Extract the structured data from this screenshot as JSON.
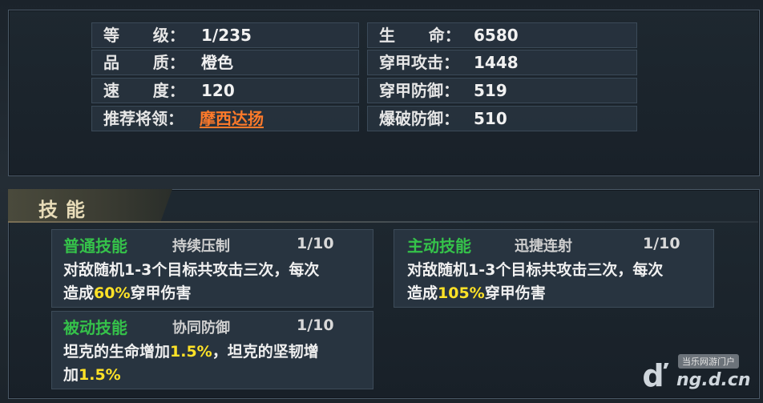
{
  "stats": {
    "left": [
      {
        "label": "等      级：",
        "value": "1/235"
      },
      {
        "label": "品      质：",
        "value": "橙色"
      },
      {
        "label": "速      度：",
        "value": "120"
      },
      {
        "label": "推荐将领：",
        "value": "摩西达扬"
      }
    ],
    "right": [
      {
        "label": "生      命：",
        "value": "6580"
      },
      {
        "label": "穿甲攻击：",
        "value": "1448"
      },
      {
        "label": "穿甲防御：",
        "value": "519"
      },
      {
        "label": "爆破防御：",
        "value": "510"
      }
    ]
  },
  "skills": {
    "title": "技能",
    "items": [
      {
        "type": "普通技能",
        "name": "持续压制",
        "level": "1/10",
        "desc_line1": "对敌随机1-3个目标共攻击三次，每次",
        "desc_line2_pre": "造成",
        "desc_line2_hl": "60%",
        "desc_line2_post": "穿甲伤害"
      },
      {
        "type": "主动技能",
        "name": "迅捷连射",
        "level": "1/10",
        "desc_line1": "对敌随机1-3个目标共攻击三次，每次",
        "desc_line2_pre": "造成",
        "desc_line2_hl": "105%",
        "desc_line2_post": "穿甲伤害"
      },
      {
        "type": "被动技能",
        "name": "协同防御",
        "level": "1/10",
        "desc_line1_pre": "坦克的生命增加",
        "desc_line1_hl": "1.5%",
        "desc_line1_post": "，坦克的坚韧增",
        "desc_line2_pre": "加",
        "desc_line2_hl": "1.5%"
      }
    ]
  },
  "watermark": {
    "tag": "当乐网游门户",
    "site": "ng.d.cn"
  },
  "colors": {
    "skill_type": "#35c24a",
    "highlight": "#ffe227",
    "general_link": "#ff7a2a"
  }
}
